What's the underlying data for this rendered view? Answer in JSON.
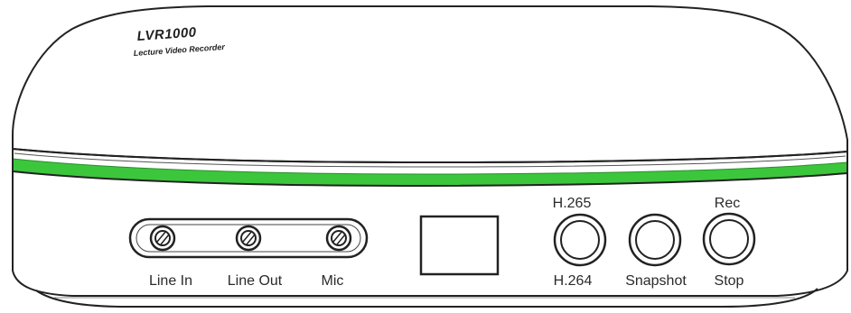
{
  "device": {
    "model": "LVR1000",
    "subtitle": "Lecture Video Recorder",
    "accent_color": "#3cc63c",
    "ports": [
      {
        "label": "Line In"
      },
      {
        "label": "Line Out"
      },
      {
        "label": "Mic"
      }
    ],
    "buttons": [
      {
        "top_label": "H.265",
        "bottom_label": "H.264"
      },
      {
        "top_label": "",
        "bottom_label": "Snapshot"
      },
      {
        "top_label": "Rec",
        "bottom_label": "Stop"
      }
    ]
  }
}
